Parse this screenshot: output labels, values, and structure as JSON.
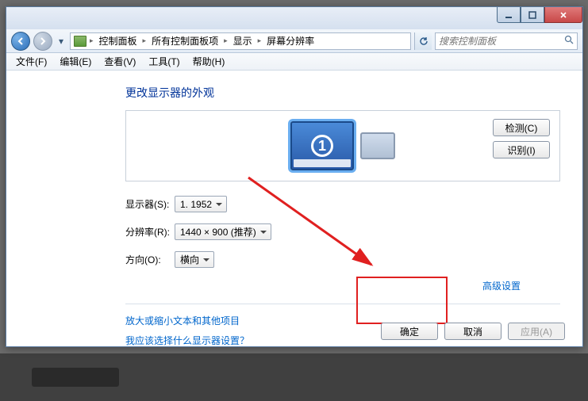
{
  "breadcrumb": {
    "items": [
      "控制面板",
      "所有控制面板项",
      "显示",
      "屏幕分辨率"
    ]
  },
  "search": {
    "placeholder": "搜索控制面板"
  },
  "menu": {
    "file": "文件(F)",
    "edit": "编辑(E)",
    "view": "查看(V)",
    "tools": "工具(T)",
    "help": "帮助(H)"
  },
  "page": {
    "heading": "更改显示器的外观",
    "detect": "检测(C)",
    "identify": "识别(I)",
    "display_label": "显示器(S):",
    "display_value": "1. 1952",
    "resolution_label": "分辨率(R):",
    "resolution_value": "1440 × 900 (推荐)",
    "orientation_label": "方向(O):",
    "orientation_value": "横向",
    "advanced": "高级设置",
    "help1": "放大或缩小文本和其他项目",
    "help2": "我应该选择什么显示器设置？"
  },
  "footer": {
    "ok": "确定",
    "cancel": "取消",
    "apply": "应用(A)"
  },
  "monitor": {
    "number": "1"
  }
}
